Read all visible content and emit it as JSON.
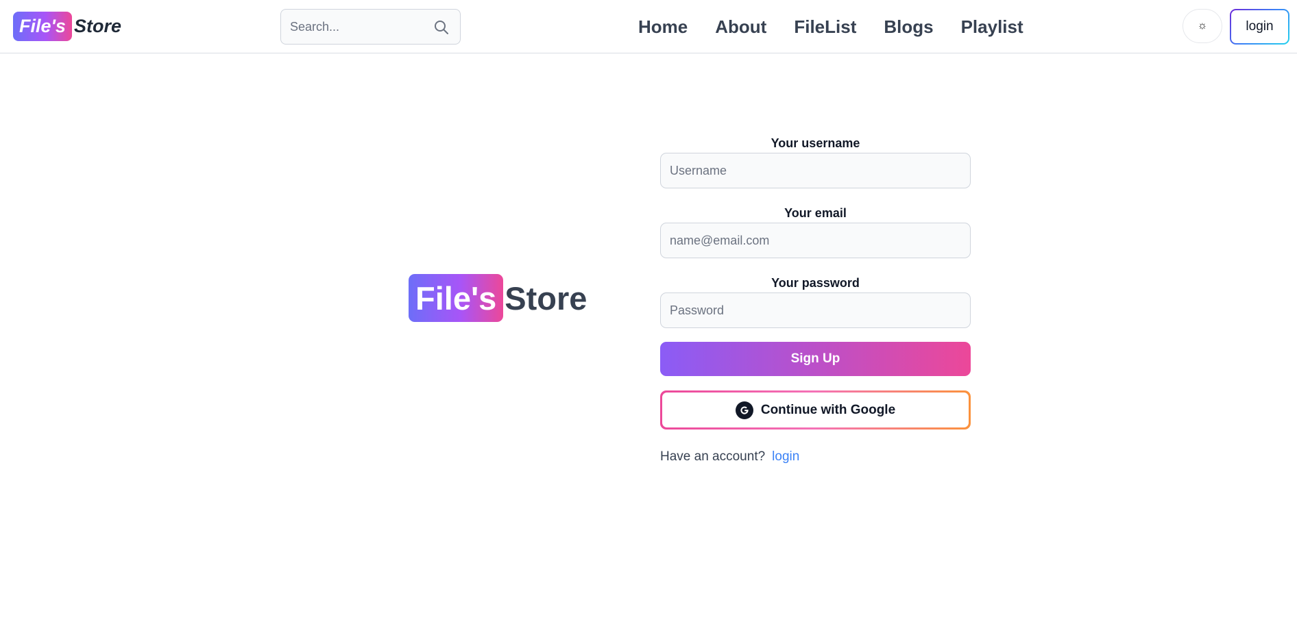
{
  "header": {
    "brand": {
      "badge": "File's",
      "rest": "Store"
    },
    "search": {
      "placeholder": "Search...",
      "icon": "search-icon"
    },
    "nav": [
      "Home",
      "About",
      "FileList",
      "Blogs",
      "Playlist"
    ],
    "theme_toggle": {
      "glyph": "☼",
      "icon": "sun-icon"
    },
    "login_label": "login"
  },
  "hero": {
    "badge": "File's",
    "rest": "Store"
  },
  "form": {
    "username": {
      "label": "Your username",
      "placeholder": "Username"
    },
    "email": {
      "label": "Your email",
      "placeholder": "name@email.com"
    },
    "password": {
      "label": "Your password",
      "placeholder": "Password"
    },
    "signup_label": "Sign Up",
    "google_label": "Continue with Google",
    "account_prompt": "Have an account?",
    "login_link": "login"
  },
  "colors": {
    "brand_gradient_start": "#6d6ef8",
    "brand_gradient_end": "#ec4899",
    "link": "#3b82f6",
    "text_dark": "#374151"
  }
}
